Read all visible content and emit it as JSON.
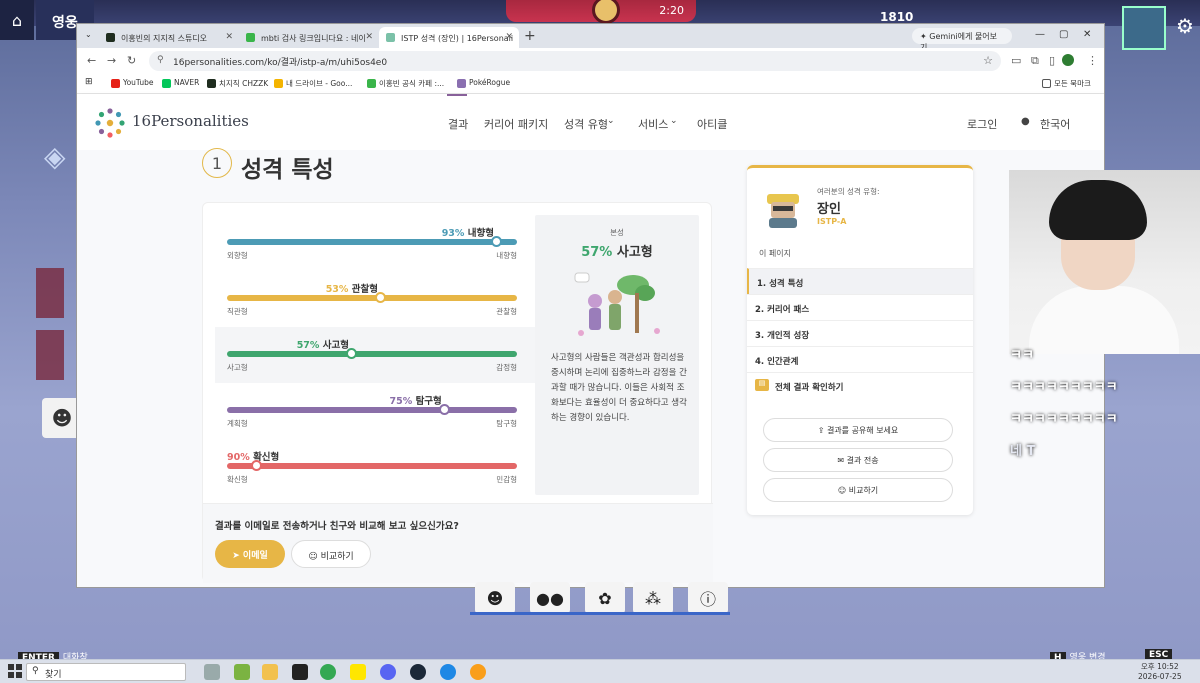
{
  "game": {
    "label": "영웅",
    "timer": "2:20",
    "score": "1810",
    "enter_label": "ENTER",
    "chat_label": "대화창",
    "hero_change_key": "H",
    "hero_change_label": "영웅 변경",
    "esc_key": "ESC"
  },
  "browser": {
    "tabs": [
      {
        "label": "이홍빈의 지지직 스튜디오",
        "color": "#1f2d1f"
      },
      {
        "label": "mbti 검사 링크입니다요 : 네이",
        "color": "#3ab54a"
      },
      {
        "label": "ISTP 성격 (장인) | 16Personali",
        "color": "#7bc1a8"
      }
    ],
    "gemini_label": "Gemini에게 물어보기",
    "url": "16personalities.com/ko/결과/istp-a/m/uhi5os4e0",
    "bookmarks": [
      {
        "label": "YouTube",
        "color": "#e62117"
      },
      {
        "label": "NAVER",
        "color": "#03c75a"
      },
      {
        "label": "치지직 CHZZK",
        "color": "#1f2d1f"
      },
      {
        "label": "내 드라이브 - Goo...",
        "color": "#f4b400"
      },
      {
        "label": "이홍빈 공식 카페 :...",
        "color": "#3ab54a"
      },
      {
        "label": "PokéRogue",
        "color": "#8a6fb0"
      }
    ],
    "all_bookmarks": "모든 북마크"
  },
  "site": {
    "logo": "16Personalities",
    "nav": [
      "결과",
      "커리어 패키지",
      "성격 유형",
      "서비스",
      "아티클"
    ],
    "login": "로그인",
    "language": "한국어",
    "section_number": "1",
    "section_title": "성격 특성",
    "traits": [
      {
        "percent": "93%",
        "name": "내향형",
        "left": "외향형",
        "right": "내향형",
        "value": 93,
        "side": "right",
        "color": "#4c9bb5"
      },
      {
        "percent": "53%",
        "name": "관찰형",
        "left": "직관형",
        "right": "관찰형",
        "value": 53,
        "side": "right",
        "color": "#e7b646"
      },
      {
        "percent": "57%",
        "name": "사고형",
        "left": "사고형",
        "right": "감정형",
        "value": 57,
        "side": "left",
        "color": "#3fa66e"
      },
      {
        "percent": "75%",
        "name": "탐구형",
        "left": "계획형",
        "right": "탐구형",
        "value": 75,
        "side": "right",
        "color": "#8a6fa8"
      },
      {
        "percent": "90%",
        "name": "확신형",
        "left": "확신형",
        "right": "민감형",
        "value": 90,
        "side": "left",
        "color": "#e36767"
      }
    ],
    "panel": {
      "label": "본성",
      "percent": "57%",
      "name": "사고형",
      "description": "사고형의 사람들은 객관성과 합리성을 중시하며 논리에 집중하느라 감정을 간과할 때가 많습니다. 이들은 사회적 조화보다는 효율성이 더 중요하다고 생각하는 경향이 있습니다."
    },
    "footer_question": "결과를 이메일로 전송하거나 친구와 비교해 보고 싶으신가요?",
    "email_button": "이메일",
    "compare_button": "비교하기",
    "profile": {
      "label": "여러분의 성격 유형:",
      "name": "장인",
      "code": "ISTP-A",
      "this_page": "이 페이지",
      "toc": [
        "1. 성격 특성",
        "2. 커리어 패스",
        "3. 개인적 성장",
        "4. 인간관계"
      ],
      "full_results": "전체 결과 확인하기",
      "share_button": "결과를 공유해 보세요",
      "send_button": "결과 전송",
      "compare_button": "비교하기"
    }
  },
  "chat": [
    "ㅋㅋ",
    "ㅋㅋㅋㅋㅋㅋㅋㅋㅋ",
    "ㅋㅋㅋㅋㅋㅋㅋㅋㅋ",
    "네 T"
  ],
  "taskbar": {
    "search_placeholder": "찾기",
    "time": "오후 10:52",
    "date": "2026-07-25"
  }
}
